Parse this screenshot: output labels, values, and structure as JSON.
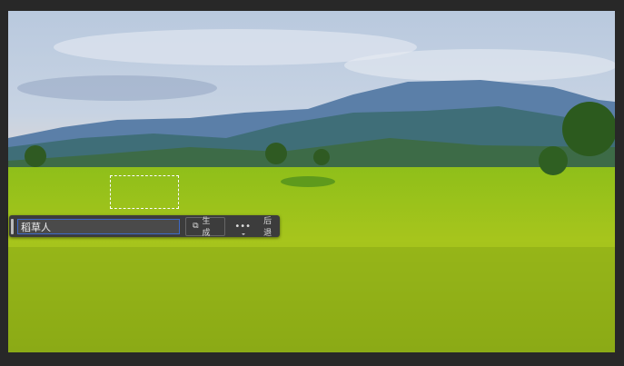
{
  "taskbar": {
    "prompt_value": "稻草人",
    "generate_label": "生成",
    "more_label": "•••",
    "back_label": "后退",
    "generate_icon": "generative-fill-icon"
  }
}
